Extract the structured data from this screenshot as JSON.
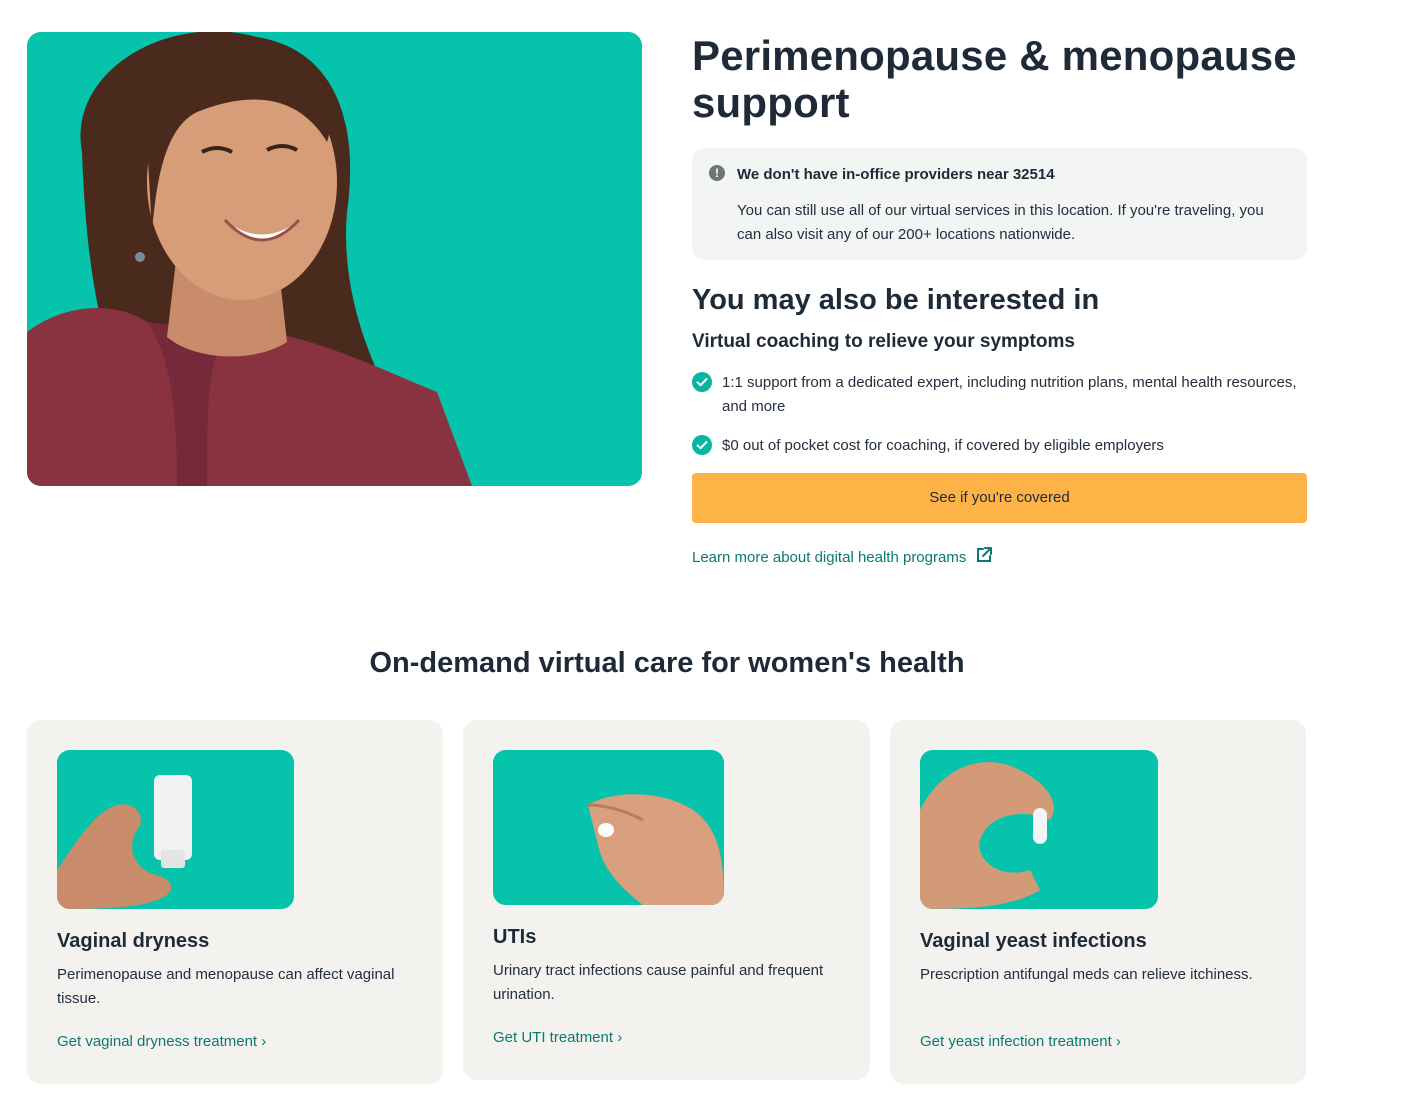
{
  "hero": {
    "image_alt": "smiling-woman-photo",
    "title": "Perimenopause & menopause support"
  },
  "alert": {
    "icon": "exclamation-icon",
    "icon_glyph": "!",
    "title": "We don't have in-office providers near 32514",
    "body": "You can still use all of our virtual services in this location. If you're traveling, you can also visit any of our 200+ locations nationwide."
  },
  "interest": {
    "heading": "You may also be interested in",
    "subheading": "Virtual coaching to relieve your symptoms",
    "benefits": [
      "1:1 support from a dedicated expert, including nutrition plans, mental health resources, and more",
      "$0 out of pocket cost for coaching, if covered by eligible employers"
    ],
    "cta_label": "See if you're covered",
    "learn_link": "Learn more about digital health programs"
  },
  "womens_health": {
    "title": "On-demand virtual care for women's health",
    "cards": [
      {
        "title": "Vaginal dryness",
        "description": "Perimenopause and menopause can affect vaginal tissue.",
        "link": "Get vaginal dryness treatment ›"
      },
      {
        "title": "UTIs",
        "description": "Urinary tract infections cause painful and frequent urination.",
        "link": "Get UTI treatment ›"
      },
      {
        "title": "Vaginal yeast infections",
        "description": "Prescription antifungal meds can relieve itchiness.",
        "link": "Get yeast infection treatment ›"
      }
    ]
  },
  "colors": {
    "teal": "#06c3ab",
    "cta": "#ffb347",
    "link": "#0b7a6e",
    "card_bg": "#f3f2ef",
    "alert_bg": "#f2f5f3",
    "heading": "#1e2a38"
  }
}
